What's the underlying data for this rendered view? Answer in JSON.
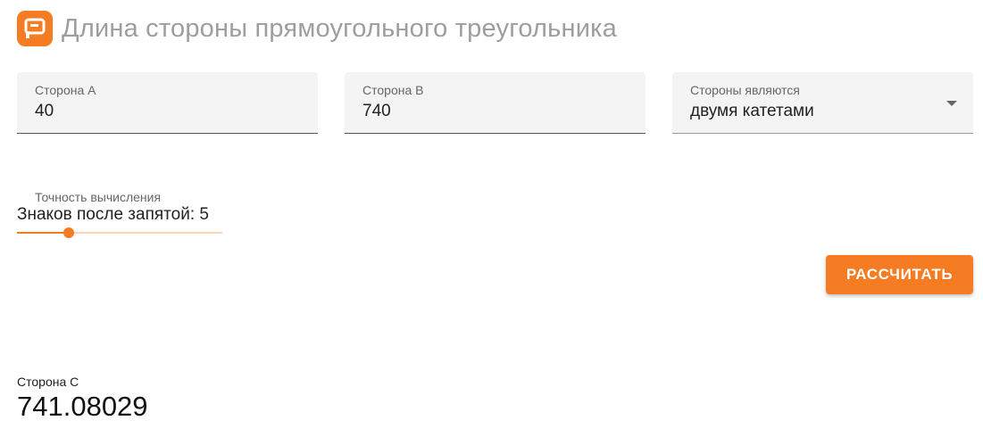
{
  "header": {
    "title": "Длина стороны прямоугольного треугольника",
    "logo_icon": "p-logo-icon",
    "logo_color": "#f57c22"
  },
  "fields": {
    "side_a": {
      "label": "Сторона A",
      "value": "40"
    },
    "side_b": {
      "label": "Сторона B",
      "value": "740"
    },
    "sides_are": {
      "label": "Стороны являются",
      "value": "двумя катетами",
      "icon": "dropdown-arrow-icon"
    }
  },
  "precision": {
    "label": "Точность вычисления",
    "value_text": "Знаков после запятой: 5",
    "slider_fraction": 0.25
  },
  "actions": {
    "calculate_label": "РАССЧИТАТЬ"
  },
  "result": {
    "label": "Сторона C",
    "value": "741.08029"
  },
  "colors": {
    "accent": "#f57c22",
    "track_light": "#fbd5b6"
  }
}
